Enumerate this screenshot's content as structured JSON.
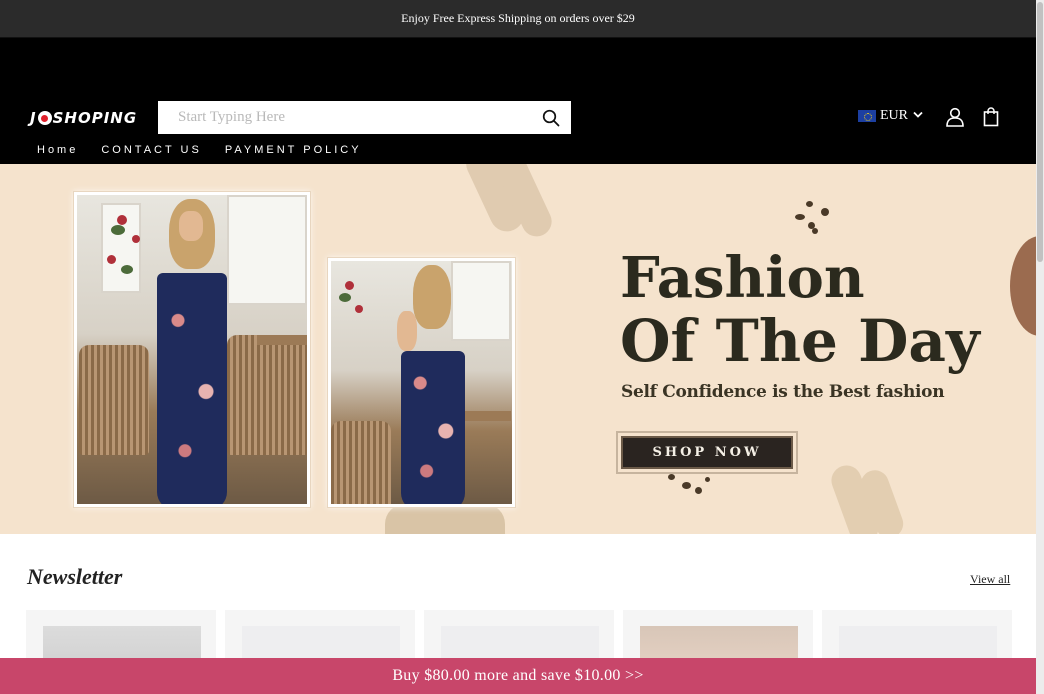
{
  "announcement": {
    "text": "Enjoy Free Express Shipping on orders over $29"
  },
  "header": {
    "logo_left": "J",
    "logo_right": "SHOPING",
    "search": {
      "placeholder": "Start Typing Here",
      "value": ""
    },
    "currency": {
      "code": "EUR",
      "flag": "eu-flag-icon"
    },
    "icons": [
      "search-icon",
      "chevron-down-icon",
      "user-icon",
      "shopping-bag-icon"
    ]
  },
  "nav": {
    "items": [
      {
        "label": "Home"
      },
      {
        "label": "CONTACT US"
      },
      {
        "label": "PAYMENT POLICY"
      }
    ]
  },
  "hero": {
    "title_line1": "Fashion",
    "title_line2": "Of The Day",
    "subtitle": "Self Confidence is the Best fashion",
    "button_label": "SHOP NOW"
  },
  "newsletter": {
    "title": "Newsletter",
    "view_all": "View all",
    "card_count_visible": 5
  },
  "promo_bar": {
    "text": "Buy $80.00 more and save $10.00   >>"
  },
  "colors": {
    "announcement_bg": "#2b2b2b",
    "header_bg": "#000000",
    "hero_bg": "#f5e3cd",
    "promo_bg": "#c8466a",
    "title_color": "#2b2a1e"
  }
}
